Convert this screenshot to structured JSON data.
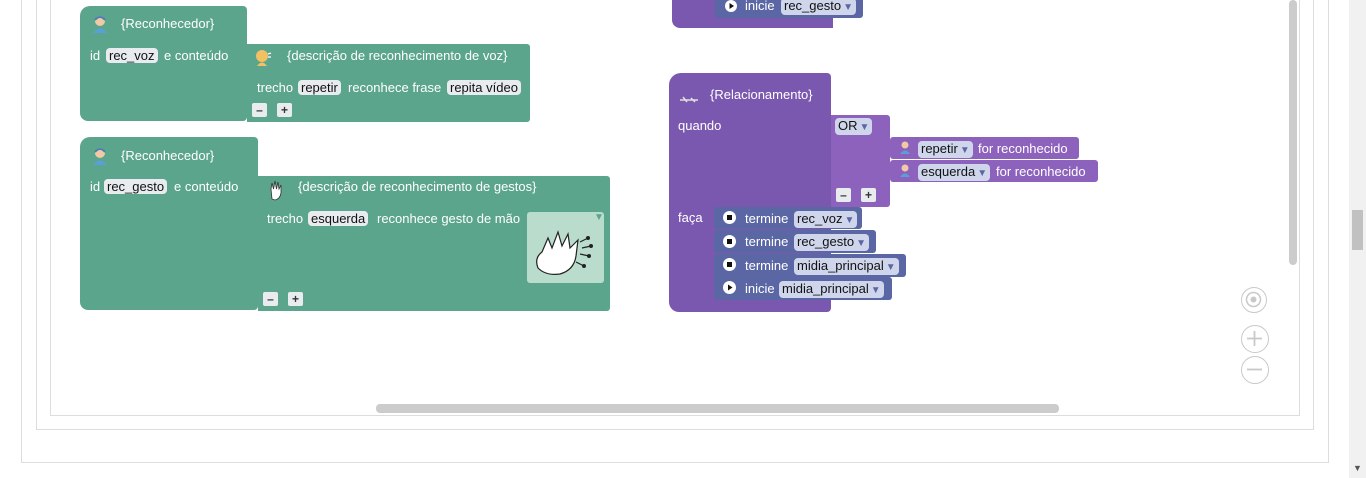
{
  "reconhecedor_voz": {
    "header": "{Reconhecedor}",
    "id_label": "id",
    "id_value": "rec_voz",
    "content_label": "e conteúdo",
    "desc": "{descrição de reconhecimento de voz}",
    "trecho_label": "trecho",
    "trecho_value": "repetir",
    "recognizes_label": "reconhece frase",
    "phrase_value": "repita vídeo",
    "minus": "–",
    "plus": "+"
  },
  "reconhecedor_gesto": {
    "header": "{Reconhecedor}",
    "id_label": "id",
    "id_value": "rec_gesto",
    "content_label": "e conteúdo",
    "desc": "{descrição de reconhecimento de gestos}",
    "trecho_label": "trecho",
    "trecho_value": "esquerda",
    "recognizes_label": "reconhece gesto de mão",
    "minus": "–",
    "plus": "+"
  },
  "top_action": {
    "label": "inicie",
    "value": "rec_gesto"
  },
  "relacionamento": {
    "header": "{Relacionamento}",
    "quando_label": "quando",
    "operator": "OR",
    "conditions": [
      {
        "value": "repetir",
        "suffix": "for reconhecido"
      },
      {
        "value": "esquerda",
        "suffix": "for reconhecido"
      }
    ],
    "minus": "–",
    "plus": "+",
    "faca_label": "faça",
    "actions": [
      {
        "verb": "termine",
        "target": "rec_voz",
        "icon": "stop-icon"
      },
      {
        "verb": "termine",
        "target": "rec_gesto",
        "icon": "stop-icon"
      },
      {
        "verb": "termine",
        "target": "midia_principal",
        "icon": "stop-icon"
      },
      {
        "verb": "inicie",
        "target": "midia_principal",
        "icon": "play-icon"
      }
    ]
  },
  "controls": {
    "recenter_icon": "crosshair-icon",
    "zoom_in_icon": "zoom-in-icon",
    "zoom_out_icon": "zoom-out-icon"
  },
  "colors": {
    "media_green": "#5ba58c",
    "relationship_purple": "#7b58b0",
    "action_blue": "#5b67a5"
  }
}
